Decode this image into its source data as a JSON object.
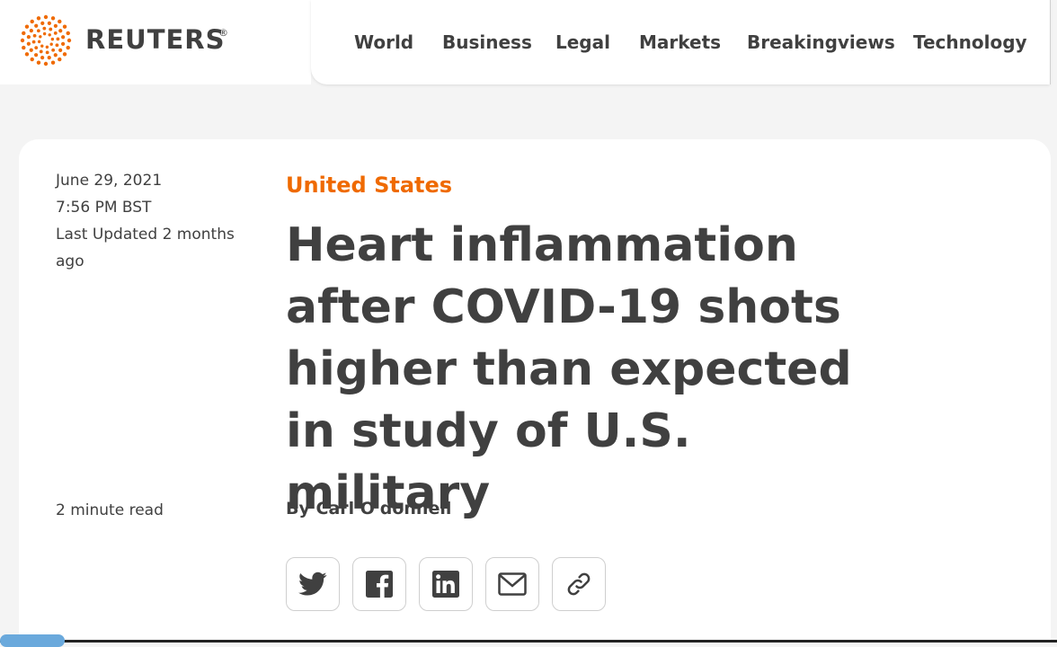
{
  "brand": {
    "name": "REUTERS",
    "registered": "®",
    "accent_color": "#ef6a00"
  },
  "nav": {
    "items": [
      {
        "label": "World"
      },
      {
        "label": "Business"
      },
      {
        "label": "Legal"
      },
      {
        "label": "Markets"
      },
      {
        "label": "Breakingviews"
      },
      {
        "label": "Technology"
      }
    ]
  },
  "article": {
    "date": "June 29, 2021",
    "time": "7:56 PM BST",
    "last_updated": "Last Updated 2 months ago",
    "read_time": "2 minute read",
    "section": "United States",
    "headline": "Heart inflammation after COVID-19 shots higher than expected in study of U.S. military",
    "byline_prefix": "By",
    "author": "Carl O'donnell"
  },
  "share": {
    "buttons": [
      {
        "icon": "twitter-icon"
      },
      {
        "icon": "facebook-icon"
      },
      {
        "icon": "linkedin-icon"
      },
      {
        "icon": "email-icon"
      },
      {
        "icon": "link-icon"
      }
    ]
  }
}
